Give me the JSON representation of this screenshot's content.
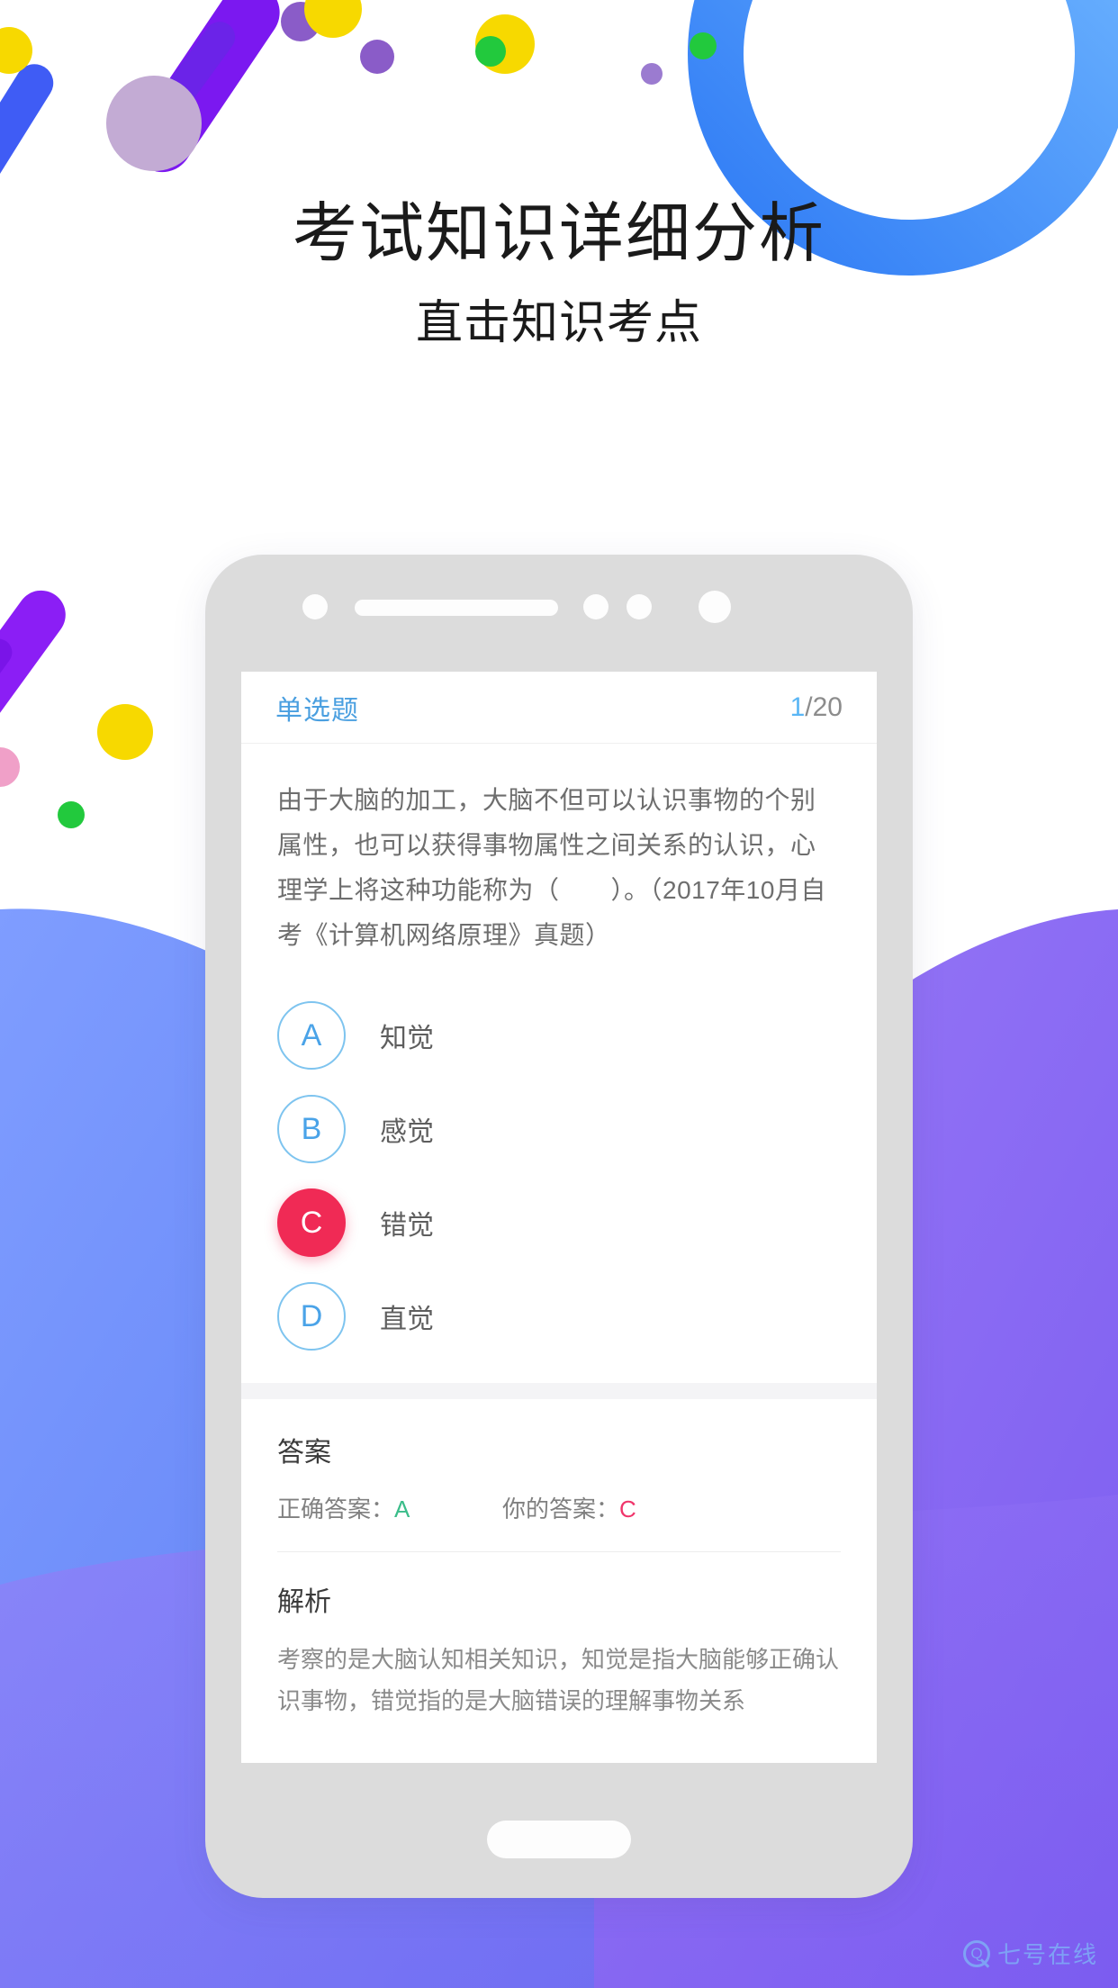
{
  "headline": {
    "title": "考试知识详细分析",
    "subtitle": "直击知识考点"
  },
  "phone": {
    "screen": {
      "header": {
        "question_type": "单选题",
        "counter_current": "1",
        "counter_total": "/20"
      },
      "question": {
        "text": "由于大脑的加工，大脑不但可以认识事物的个别属性，也可以获得事物属性之间关系的认识，心理学上将这种功能称为（　　）。（2017年10月自考《计算机网络原理》真题）",
        "options": [
          {
            "key": "A",
            "label": "知觉",
            "selected": false
          },
          {
            "key": "B",
            "label": "感觉",
            "selected": false
          },
          {
            "key": "C",
            "label": "错觉",
            "selected": true
          },
          {
            "key": "D",
            "label": "直觉",
            "selected": false
          }
        ]
      },
      "answer": {
        "section_title": "答案",
        "correct_label": "正确答案：",
        "correct_value": "A",
        "your_label": "你的答案：",
        "your_value": "C"
      },
      "analysis": {
        "section_title": "解析",
        "text": "考察的是大脑认知相关知识，知觉是指大脑能够正确认识事物，错觉指的是大脑错误的理解事物关系"
      }
    }
  },
  "watermark": {
    "logo": "Q",
    "text": "七号在线"
  },
  "colors": {
    "accent_blue": "#4a9fe0",
    "selected_red": "#f02a55",
    "correct_green": "#3bbd8a",
    "wrong_red": "#f0356b",
    "counter_blue": "#5ab6f5",
    "phone_body": "#dcdcdc",
    "bg_purple": "#7b61f0",
    "bg_blue": "#5b83f5"
  }
}
